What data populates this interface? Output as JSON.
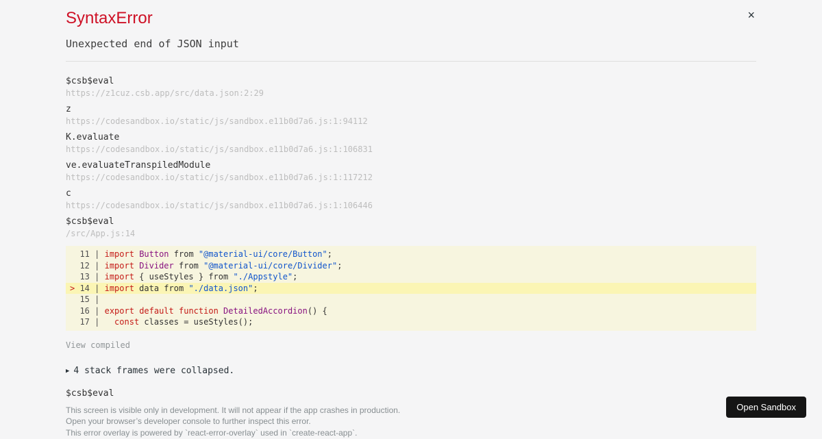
{
  "error_overlay": {
    "title": "SyntaxError",
    "title_color": "#ce1126",
    "message": "Unexpected end of JSON input",
    "close_label": "×"
  },
  "stack_trace": {
    "frames": [
      {
        "fn": "$csb$eval",
        "location": "https://z1cuz.csb.app/src/data.json:2:29"
      },
      {
        "fn": "z",
        "location": "https://codesandbox.io/static/js/sandbox.e11b0d7a6.js:1:94112"
      },
      {
        "fn": "K.evaluate",
        "location": "https://codesandbox.io/static/js/sandbox.e11b0d7a6.js:1:106831"
      },
      {
        "fn": "ve.evaluateTranspiledModule",
        "location": "https://codesandbox.io/static/js/sandbox.e11b0d7a6.js:1:117212"
      },
      {
        "fn": "c",
        "location": "https://codesandbox.io/static/js/sandbox.e11b0d7a6.js:1:106446"
      },
      {
        "fn": "$csb$eval",
        "location": "/src/App.js:14"
      }
    ],
    "view_compiled_label": "View compiled",
    "collapsed_toggle": {
      "icon": "▶",
      "label": "4 stack frames were collapsed."
    },
    "trailing_frame_fn": "$csb$eval"
  },
  "code_frame": {
    "background": "rgba(251,245,180,0.35)",
    "highlight_color": "#fbf5b4",
    "keyword_color": "#c41a16",
    "capitalized_color": "#881280",
    "string_color": "#1155cc",
    "lines": [
      {
        "number": "11",
        "highlighted": false,
        "tokens": [
          [
            "k",
            "import"
          ],
          [
            "p",
            " "
          ],
          [
            "c",
            "Button"
          ],
          [
            "p",
            " from "
          ],
          [
            "s",
            "\"@material-ui/core/Button\""
          ],
          [
            "p",
            ";"
          ]
        ]
      },
      {
        "number": "12",
        "highlighted": false,
        "tokens": [
          [
            "k",
            "import"
          ],
          [
            "p",
            " "
          ],
          [
            "c",
            "Divider"
          ],
          [
            "p",
            " from "
          ],
          [
            "s",
            "\"@material-ui/core/Divider\""
          ],
          [
            "p",
            ";"
          ]
        ]
      },
      {
        "number": "13",
        "highlighted": false,
        "tokens": [
          [
            "k",
            "import"
          ],
          [
            "p",
            " { useStyles } from "
          ],
          [
            "s",
            "\"./Appstyle\""
          ],
          [
            "p",
            ";"
          ]
        ]
      },
      {
        "number": "14",
        "highlighted": true,
        "tokens": [
          [
            "k",
            "import"
          ],
          [
            "p",
            " data from "
          ],
          [
            "s",
            "\"./data.json\""
          ],
          [
            "p",
            ";"
          ]
        ]
      },
      {
        "number": "15",
        "highlighted": false,
        "tokens": []
      },
      {
        "number": "16",
        "highlighted": false,
        "tokens": [
          [
            "k",
            "export"
          ],
          [
            "p",
            " "
          ],
          [
            "k",
            "default"
          ],
          [
            "p",
            " "
          ],
          [
            "k",
            "function"
          ],
          [
            "p",
            " "
          ],
          [
            "c",
            "DetailedAccordion"
          ],
          [
            "p",
            "() {"
          ]
        ]
      },
      {
        "number": "17",
        "highlighted": false,
        "tokens": [
          [
            "p",
            "  "
          ],
          [
            "k",
            "const"
          ],
          [
            "p",
            " classes = useStyles();"
          ]
        ]
      }
    ]
  },
  "footer": {
    "lines": [
      "This screen is visible only in development. It will not appear if the app crashes in production.",
      "Open your browser’s developer console to further inspect this error.",
      "This error overlay is powered by `react-error-overlay` used in `create-react-app`."
    ]
  },
  "open_sandbox_button": {
    "label": "Open Sandbox",
    "background": "#151515",
    "text_color": "#ffffff"
  }
}
